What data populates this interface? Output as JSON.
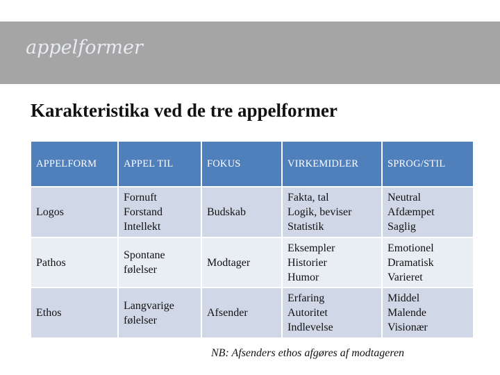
{
  "banner": {
    "title": "appelformer"
  },
  "heading": "Karakteristika ved de tre appelformer",
  "table": {
    "headers": [
      "APPELFORM",
      "APPEL TIL",
      "FOKUS",
      "VIRKEMIDLER",
      "SPROG/STIL"
    ],
    "rows": [
      {
        "appelform": "Logos",
        "appel_til": [
          "Fornuft",
          "Forstand",
          "Intellekt"
        ],
        "fokus": "Budskab",
        "virkemidler": [
          "Fakta, tal",
          "Logik, beviser",
          "Statistik"
        ],
        "sprog_stil": [
          "Neutral",
          "Afdæmpet",
          "Saglig"
        ]
      },
      {
        "appelform": "Pathos",
        "appel_til": [
          "Spontane",
          "følelser"
        ],
        "fokus": "Modtager",
        "virkemidler": [
          "Eksempler",
          "Historier",
          "Humor"
        ],
        "sprog_stil": [
          "Emotionel",
          "Dramatisk",
          "Varieret"
        ]
      },
      {
        "appelform": "Ethos",
        "appel_til": [
          "Langvarige",
          "følelser"
        ],
        "fokus": "Afsender",
        "virkemidler": [
          "Erfaring",
          "Autoritet",
          "Indlevelse"
        ],
        "sprog_stil": [
          "Middel",
          "Malende",
          "Visionær"
        ]
      }
    ]
  },
  "note": "NB: Afsenders ethos afgøres af modtageren",
  "colors": {
    "banner_bg": "#a5a5a5",
    "header_bg": "#4f80bc",
    "row_dark": "#d0d8e7",
    "row_light": "#e9edf4"
  }
}
